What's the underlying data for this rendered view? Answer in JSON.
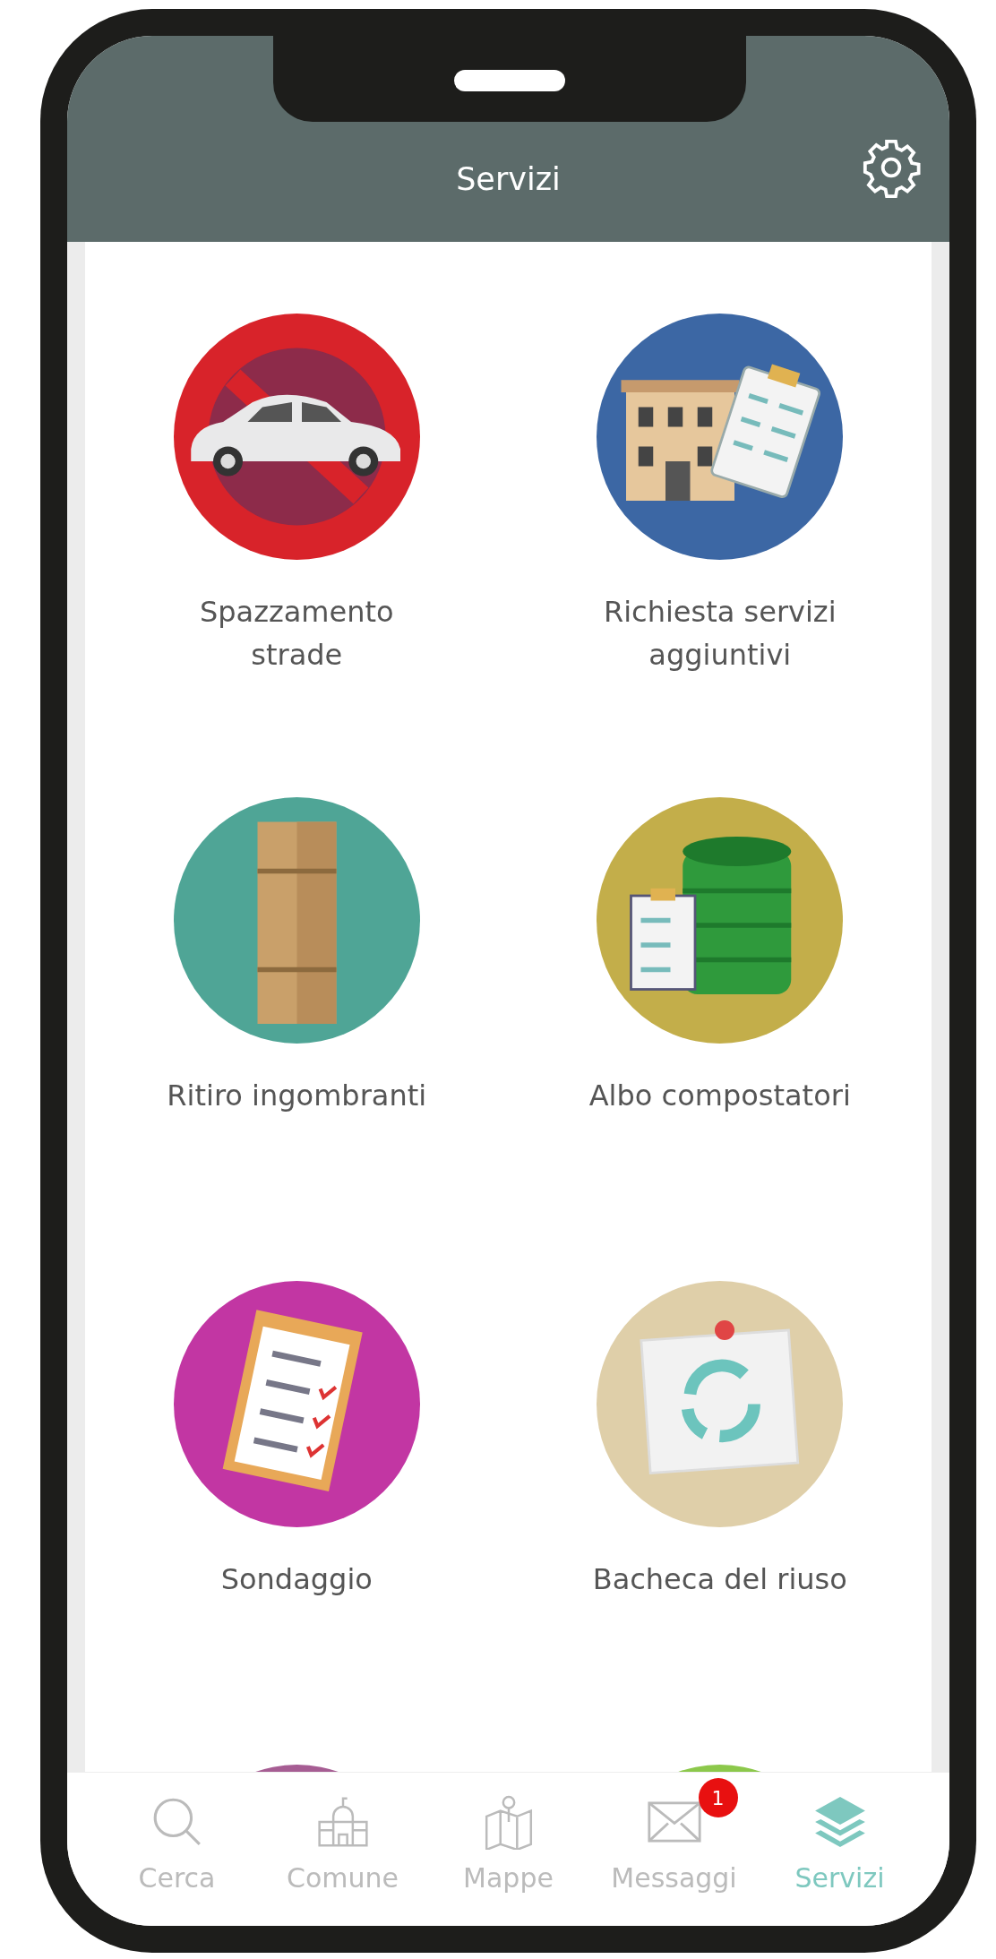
{
  "header": {
    "title": "Servizi"
  },
  "tiles": [
    {
      "kind": "car",
      "label": "Spazzamento strade",
      "color": "#d8232a"
    },
    {
      "kind": "building",
      "label": "Richiesta servizi aggiuntivi",
      "color": "#3c67a4"
    },
    {
      "kind": "box",
      "label": "Ritiro ingombranti",
      "color": "#4fa596"
    },
    {
      "kind": "bin",
      "label": "Albo compostatori",
      "color": "#c3ae4a"
    },
    {
      "kind": "clipboard",
      "label": "Sondaggio",
      "color": "#c236a3"
    },
    {
      "kind": "note",
      "label": "Bacheca del riuso",
      "color": "#dfcfa9"
    }
  ],
  "partial_tiles": [
    {
      "color": "#a65d93"
    },
    {
      "color": "#8cc84b"
    }
  ],
  "nav": [
    {
      "kind": "search",
      "label": "Cerca",
      "selected": false
    },
    {
      "kind": "townhall",
      "label": "Comune",
      "selected": false
    },
    {
      "kind": "map",
      "label": "Mappe",
      "selected": false
    },
    {
      "kind": "mail",
      "label": "Messaggi",
      "selected": false,
      "badge": "1"
    },
    {
      "kind": "layers",
      "label": "Servizi",
      "selected": true
    }
  ]
}
